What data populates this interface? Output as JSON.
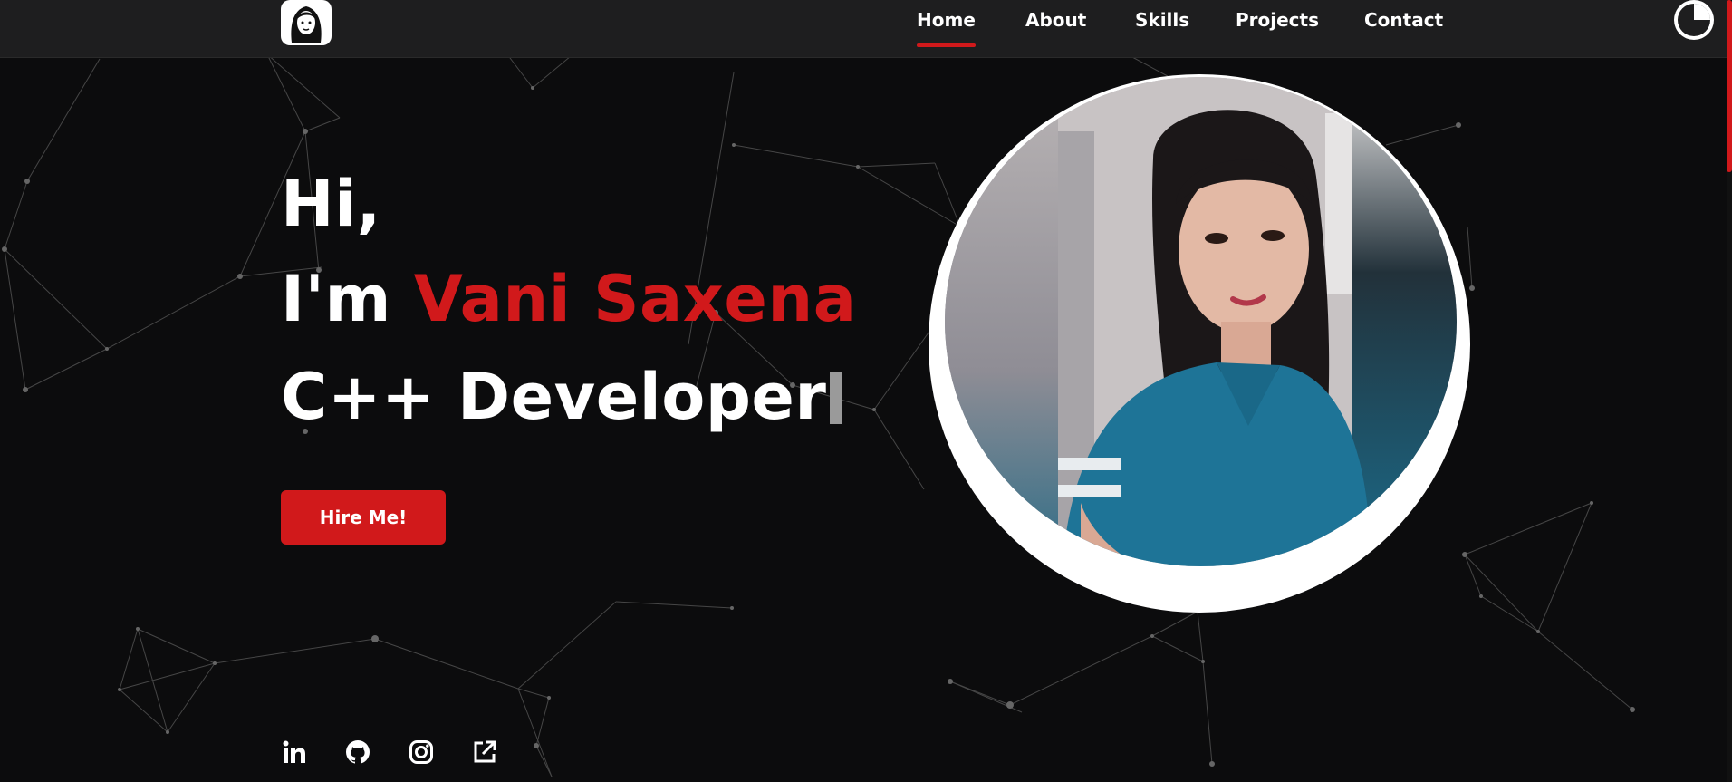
{
  "nav": {
    "items": [
      {
        "label": "Home",
        "active": true
      },
      {
        "label": "About",
        "active": false
      },
      {
        "label": "Skills",
        "active": false
      },
      {
        "label": "Projects",
        "active": false
      },
      {
        "label": "Contact",
        "active": false
      }
    ],
    "theme_toggle_icon": "moon-icon",
    "logo_icon": "woman-avatar-icon"
  },
  "hero": {
    "greeting": "Hi,",
    "intro_prefix": "I'm ",
    "name": "Vani Saxena",
    "role": "C++ Developer",
    "hire_button": "Hire Me!"
  },
  "socials": [
    {
      "icon": "linkedin-icon"
    },
    {
      "icon": "github-icon"
    },
    {
      "icon": "instagram-icon"
    },
    {
      "icon": "external-link-icon"
    }
  ],
  "colors": {
    "accent": "#d1191b",
    "background": "#0c0c0d",
    "navbar": "#1e1e1f",
    "text": "#ffffff"
  }
}
